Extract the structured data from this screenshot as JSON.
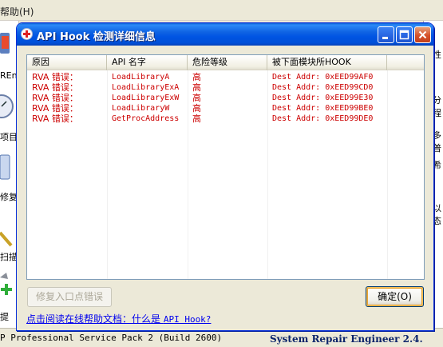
{
  "background": {
    "menu_help": "帮助(H)",
    "sidebar_labels": [
      "REna",
      "项目",
      "修复",
      "扫描",
      "提"
    ],
    "main_fragments": [
      "性",
      "分程",
      "多普",
      "希",
      "以态"
    ],
    "status_left": "P Professional Service Pack 2 (Build 2600)",
    "status_right": "System Repair Engineer 2.4."
  },
  "dialog": {
    "title": "API Hook 检测详细信息",
    "columns": [
      "原因",
      "API 名字",
      "危险等级",
      "被下面模块所HOOK"
    ],
    "rows": [
      {
        "reason": "RVA 错误：",
        "api": "LoadLibraryA",
        "level": "高",
        "hook": "Dest Addr: 0xEED99AF0"
      },
      {
        "reason": "RVA 错误：",
        "api": "LoadLibraryExA",
        "level": "高",
        "hook": "Dest Addr: 0xEED99CD0"
      },
      {
        "reason": "RVA 错误：",
        "api": "LoadLibraryExW",
        "level": "高",
        "hook": "Dest Addr: 0xEED99E30"
      },
      {
        "reason": "RVA 错误：",
        "api": "LoadLibraryW",
        "level": "高",
        "hook": "Dest Addr: 0xEED99BE0"
      },
      {
        "reason": "RVA 错误：",
        "api": "GetProcAddress",
        "level": "高",
        "hook": "Dest Addr: 0xEED99DE0"
      }
    ],
    "fix_button": "修复入口点错误",
    "ok_button": "确定(O)",
    "help_link_prefix": "点击阅读在线帮助文档：什么是 ",
    "help_link_term": "API Hook?",
    "text_color": "#cc0000",
    "title_color": "#0054e3"
  }
}
